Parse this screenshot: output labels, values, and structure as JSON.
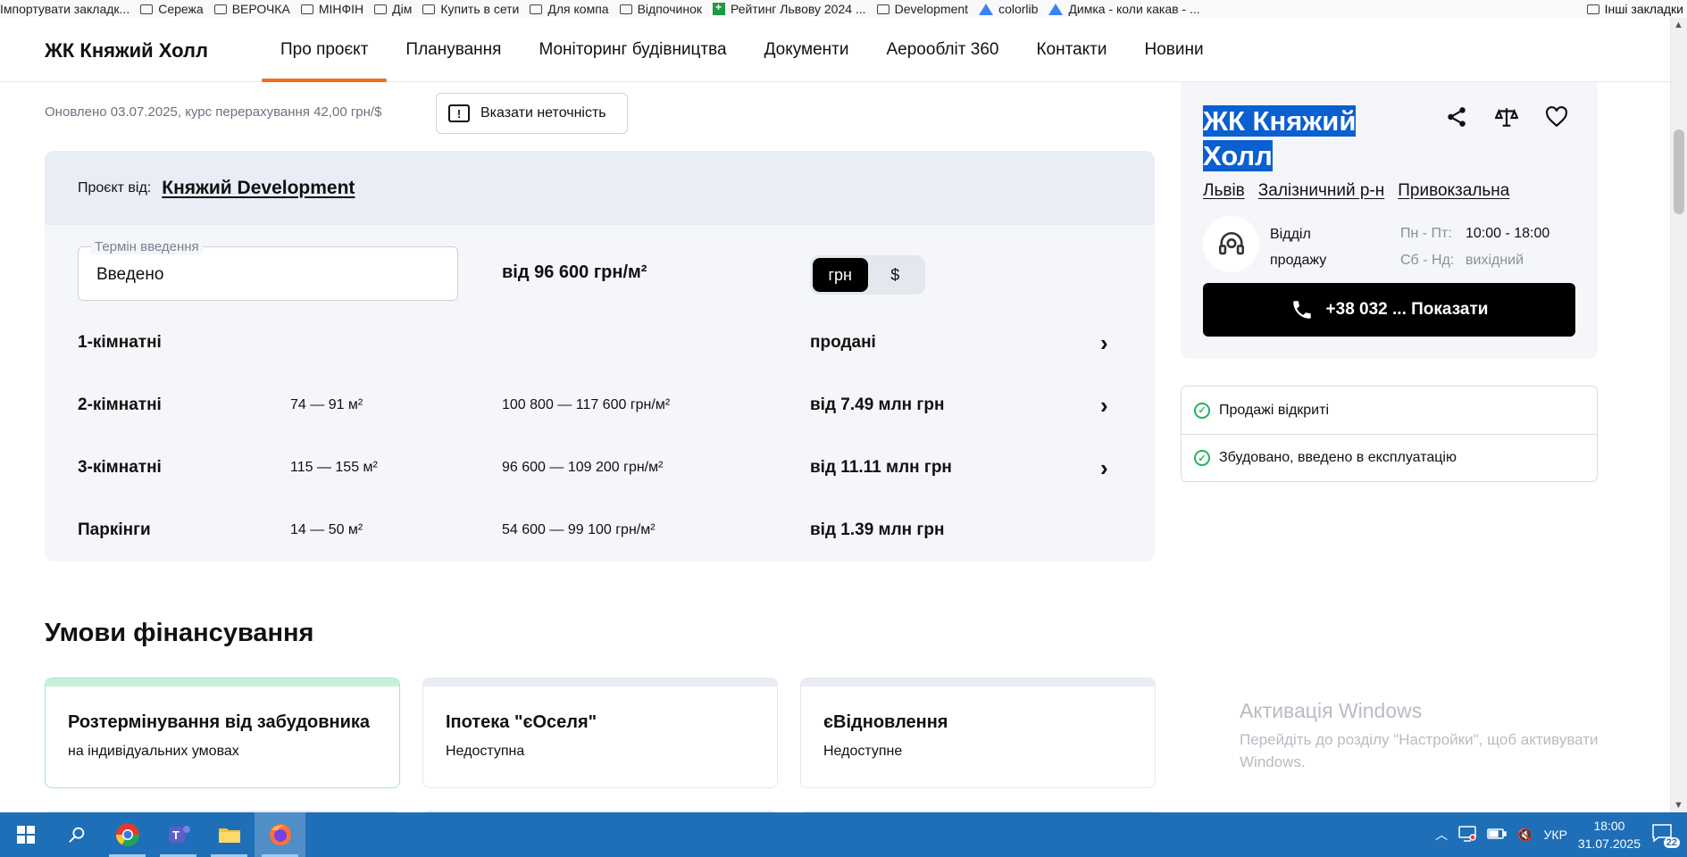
{
  "bookmarks": {
    "items": [
      "Імпортувати закладк...",
      "Сережа",
      "ВЕРОЧКА",
      "МІНФІН",
      "Дім",
      "Купить в сети",
      "Для компа",
      "Відпочинок",
      "Рейтинг Львову 2024 ...",
      "Development",
      "colorlib",
      "Димка - коли какав - ..."
    ],
    "other": "Інші закладки"
  },
  "header": {
    "logo": "ЖК Княжий Холл",
    "nav": [
      "Про проєкт",
      "Планування",
      "Моніторинг будівництва",
      "Документи",
      "Аерообліт 360",
      "Контакти",
      "Новини"
    ]
  },
  "info": {
    "updated": "Оновлено 03.07.2025, курс перерахування 42,00 грн/$",
    "report_button": "Вказати неточність"
  },
  "card": {
    "project_by_label": "Проєкт від:",
    "developer": "Княжий Development",
    "term_label": "Термін введення",
    "term_value": "Введено",
    "price_from": "від 96 600 грн/м²",
    "currency": [
      "грн",
      "$"
    ],
    "rows": [
      {
        "name": "1-кімнатні",
        "area": "",
        "ppm": "",
        "total": "продані",
        "arrow": true
      },
      {
        "name": "2-кімнатні",
        "area": "74 — 91 м²",
        "ppm": "100 800 — 117 600 грн/м²",
        "total": "від 7.49 млн грн",
        "arrow": true
      },
      {
        "name": "3-кімнатні",
        "area": "115 — 155 м²",
        "ppm": "96 600 — 109 200 грн/м²",
        "total": "від 11.11 млн грн",
        "arrow": true
      },
      {
        "name": "Паркінги",
        "area": "14 — 50 м²",
        "ppm": "54 600 — 99 100 грн/м²",
        "total": "від 1.39 млн грн",
        "arrow": false
      }
    ]
  },
  "finance": {
    "title": "Умови фінансування",
    "cards": [
      {
        "title": "Розтермінування від забудовника",
        "subtitle": "на індивідуальних умовах"
      },
      {
        "title": "Іпотека \"єОселя\"",
        "subtitle": "Недоступна"
      },
      {
        "title": "єВідновлення",
        "subtitle": "Недоступне"
      }
    ]
  },
  "side": {
    "title_line1": "ЖК Княжий",
    "title_line2": "Холл",
    "locations": [
      "Львів",
      "Залізничний р-н",
      "Привокзальна"
    ],
    "agent_label": "Відділ продажу",
    "hours": [
      {
        "days": "Пн - Пт:",
        "time": "10:00 - 18:00"
      },
      {
        "days": "Сб - Нд:",
        "time": "вихідний"
      }
    ],
    "call_button": "+38 032 ... Показати",
    "statuses": [
      "Продажі відкриті",
      "Збудовано, введено в експлуатацію"
    ]
  },
  "watermark": {
    "title": "Активація Windows",
    "text": "Перейдіть до розділу \"Настройки\", щоб активувати Windows."
  },
  "taskbar": {
    "lang": "УКР",
    "time": "18:00",
    "date": "31.07.2025",
    "notifications": "22"
  }
}
